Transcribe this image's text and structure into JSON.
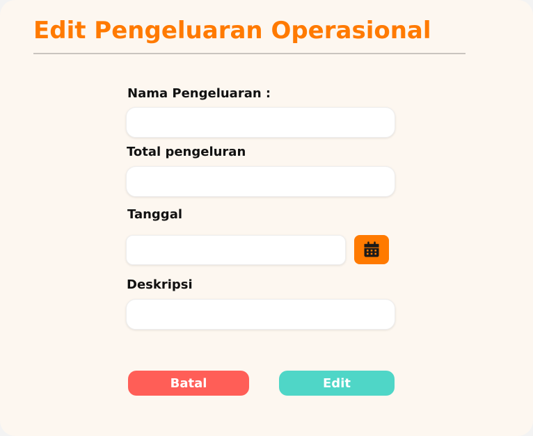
{
  "header": {
    "title": "Edit Pengeluaran Operasional"
  },
  "form": {
    "nama": {
      "label": "Nama Pengeluaran :",
      "value": ""
    },
    "total": {
      "label": "Total pengeluran",
      "value": ""
    },
    "tanggal": {
      "label": "Tanggal",
      "value": "",
      "icon": "calendar-icon"
    },
    "deskripsi": {
      "label": "Deskripsi",
      "value": ""
    }
  },
  "actions": {
    "cancel_label": "Batal",
    "submit_label": "Edit"
  },
  "colors": {
    "title": "#ff7a00",
    "calendar_button": "#ff7a00",
    "cancel": "#ff5e57",
    "submit": "#4fd6c7",
    "card_background": "#fdf7f0"
  }
}
